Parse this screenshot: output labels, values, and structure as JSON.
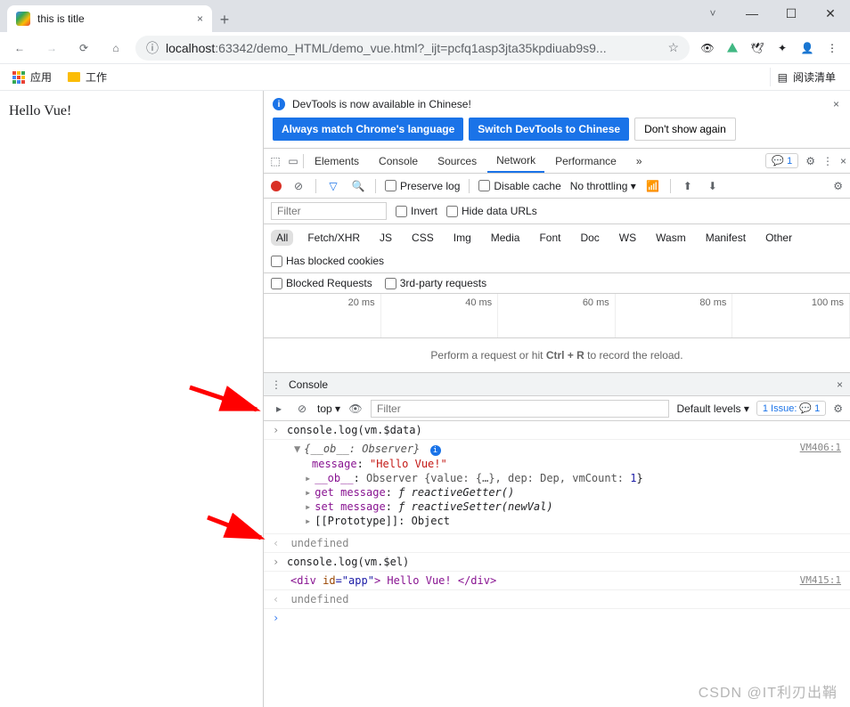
{
  "tab": {
    "title": "this is title"
  },
  "url": {
    "host": "localhost",
    "rest": ":63342/demo_HTML/demo_vue.html?_ijt=pcfq1asp3jta35kpdiuab9s9..."
  },
  "bookmarks": {
    "apps": "应用",
    "folder": "工作",
    "reading_list": "阅读清单"
  },
  "page": {
    "content": "Hello Vue!"
  },
  "banner": {
    "message": "DevTools is now available in Chinese!",
    "btn_match": "Always match Chrome's language",
    "btn_switch": "Switch DevTools to Chinese",
    "btn_dont": "Don't show again"
  },
  "tabs": {
    "elements": "Elements",
    "console": "Console",
    "sources": "Sources",
    "network": "Network",
    "performance": "Performance"
  },
  "issues_count": "1",
  "network": {
    "preserve_log": "Preserve log",
    "disable_cache": "Disable cache",
    "throttling": "No throttling",
    "filter_placeholder": "Filter",
    "invert": "Invert",
    "hide_urls": "Hide data URLs",
    "types": [
      "All",
      "Fetch/XHR",
      "JS",
      "CSS",
      "Img",
      "Media",
      "Font",
      "Doc",
      "WS",
      "Wasm",
      "Manifest",
      "Other"
    ],
    "has_blocked": "Has blocked cookies",
    "blocked_req": "Blocked Requests",
    "third_party": "3rd-party requests",
    "timeline": [
      "20 ms",
      "40 ms",
      "60 ms",
      "80 ms",
      "100 ms"
    ],
    "empty_prefix": "Perform a request or hit ",
    "empty_key": "Ctrl + R",
    "empty_suffix": " to record the reload."
  },
  "console_drawer": {
    "title": "Console",
    "context": "top",
    "filter_placeholder": "Filter",
    "default_levels": "Default levels",
    "issues_label": "1 Issue:",
    "issues_count": "1"
  },
  "logs": {
    "cmd1": "console.log(vm.$data)",
    "src1": "VM406:1",
    "obj_head": "{__ob__: Observer}",
    "message_key": "message",
    "message_val": "\"Hello Vue!\"",
    "ob_key": "__ob__",
    "ob_val": "Observer {value: {…}, dep: Dep, vmCount: ",
    "ob_count": "1",
    "getter_key": "get message",
    "getter_val": "ƒ reactiveGetter()",
    "setter_key": "set message",
    "setter_val": "ƒ reactiveSetter(newVal)",
    "proto_key": "[[Prototype]]",
    "proto_val": "Object",
    "undef": "undefined",
    "cmd2": "console.log(vm.$el)",
    "src2": "VM415:1",
    "el_open": "<div ",
    "el_id_attr": "id",
    "el_id_val": "=\"app\"",
    "el_mid": "> Hello Vue! ",
    "el_close": "</div>"
  },
  "watermark": "CSDN @IT利刃出鞘"
}
